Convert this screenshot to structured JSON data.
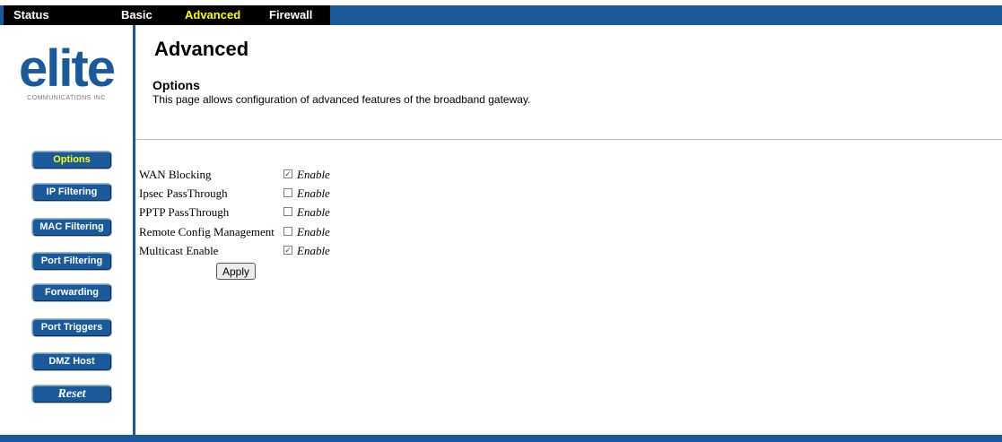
{
  "topnav": {
    "items": [
      {
        "label": "Status",
        "active": false
      },
      {
        "label": "Basic",
        "active": false
      },
      {
        "label": "Advanced",
        "active": true
      },
      {
        "label": "Firewall",
        "active": false
      }
    ]
  },
  "logo": {
    "word": "elite",
    "tagline": "COMMUNICATIONS INC"
  },
  "sidebar": {
    "items": [
      {
        "label": "Options",
        "active": true
      },
      {
        "label": "IP Filtering",
        "active": false
      },
      {
        "label": "MAC Filtering",
        "active": false
      },
      {
        "label": "Port Filtering",
        "active": false
      },
      {
        "label": "Forwarding",
        "active": false
      },
      {
        "label": "Port Triggers",
        "active": false
      },
      {
        "label": "DMZ Host",
        "active": false
      },
      {
        "label": "Reset",
        "active": false
      }
    ]
  },
  "main": {
    "title": "Advanced",
    "section_title": "Options",
    "description": "This page allows configuration of advanced features of the broadband gateway.",
    "options": [
      {
        "label": "WAN Blocking",
        "enable_label": "Enable",
        "checked": true
      },
      {
        "label": "Ipsec PassThrough",
        "enable_label": "Enable",
        "checked": false
      },
      {
        "label": "PPTP PassThrough",
        "enable_label": "Enable",
        "checked": false
      },
      {
        "label": "Remote Config Management",
        "enable_label": "Enable",
        "checked": false
      },
      {
        "label": "Multicast Enable",
        "enable_label": "Enable",
        "checked": true
      }
    ],
    "apply_label": "Apply"
  },
  "colors": {
    "brand_blue": "#1a5a9a",
    "active_nav": "#ffff00"
  }
}
